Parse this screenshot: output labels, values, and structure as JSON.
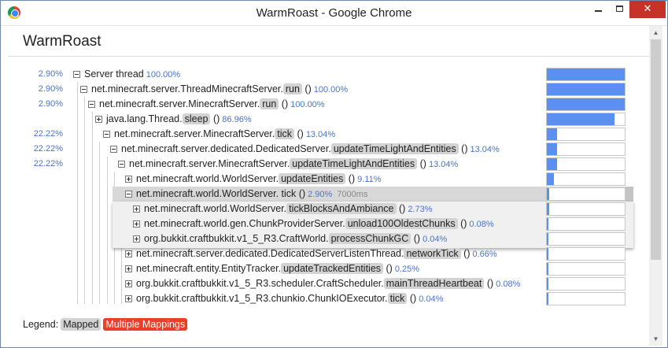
{
  "window": {
    "title": "WarmRoast - Google Chrome",
    "close_glyph": "✕",
    "min_icon": "minimize-icon",
    "max_icon": "maximize-icon",
    "close_icon": "close-icon"
  },
  "app": {
    "title": "WarmRoast"
  },
  "colors": {
    "accent_blue": "#4a74c8",
    "bar_fill": "#5b8ff1",
    "method_bg": "#d3d3d3",
    "multiple_mappings": "#e8402a",
    "close_button": "#c7312a"
  },
  "rows": [
    {
      "pct": "2.90%",
      "prefix": "Server thread",
      "method": "",
      "suffix": "",
      "nodepct": "100.00%",
      "time": "",
      "bar": 1.0,
      "toggle": "minus"
    },
    {
      "pct": "2.90%",
      "prefix": "net.minecraft.server.ThreadMinecraftServer.",
      "method": "run",
      "suffix": " ()",
      "nodepct": "100.00%",
      "time": "",
      "bar": 1.0,
      "toggle": "minus"
    },
    {
      "pct": "2.90%",
      "prefix": "net.minecraft.server.MinecraftServer.",
      "method": "run",
      "suffix": " ()",
      "nodepct": "100.00%",
      "time": "",
      "bar": 1.0,
      "toggle": "minus"
    },
    {
      "pct": "",
      "prefix": "java.lang.Thread.",
      "method": "sleep",
      "suffix": " ()",
      "nodepct": "86.96%",
      "time": "",
      "bar": 0.8696,
      "toggle": "plus"
    },
    {
      "pct": "22.22%",
      "prefix": "net.minecraft.server.MinecraftServer.",
      "method": "tick",
      "suffix": " ()",
      "nodepct": "13.04%",
      "time": "",
      "bar": 0.1304,
      "toggle": "minus"
    },
    {
      "pct": "22.22%",
      "prefix": "net.minecraft.server.dedicated.DedicatedServer.",
      "method": "updateTimeLightAndEntities",
      "suffix": " ()",
      "nodepct": "13.04%",
      "time": "",
      "bar": 0.1304,
      "toggle": "minus"
    },
    {
      "pct": "22.22%",
      "prefix": "net.minecraft.server.MinecraftServer.",
      "method": "updateTimeLightAndEntities",
      "suffix": " ()",
      "nodepct": "13.04%",
      "time": "",
      "bar": 0.1304,
      "toggle": "minus"
    },
    {
      "pct": "",
      "prefix": "net.minecraft.world.WorldServer.",
      "method": "updateEntities",
      "suffix": " ()",
      "nodepct": "9.11%",
      "time": "",
      "bar": 0.0911,
      "toggle": "plus"
    },
    {
      "pct": "",
      "prefix": "net.minecraft.world.WorldServer. tick ()",
      "method": "",
      "suffix": "",
      "nodepct": "2.90%",
      "time": "7000ms",
      "bar": 0.029,
      "toggle": "minus"
    },
    {
      "pct": "",
      "prefix": "net.minecraft.world.WorldServer.",
      "method": "tickBlocksAndAmbiance",
      "suffix": " ()",
      "nodepct": "2.73%",
      "time": "",
      "bar": 0.0273,
      "toggle": "plus"
    },
    {
      "pct": "",
      "prefix": "net.minecraft.world.gen.ChunkProviderServer.",
      "method": "unload100OldestChunks",
      "suffix": " ()",
      "nodepct": "0.08%",
      "time": "",
      "bar": 0.0008,
      "toggle": "plus"
    },
    {
      "pct": "",
      "prefix": "org.bukkit.craftbukkit.v1_5_R3.CraftWorld.",
      "method": "processChunkGC",
      "suffix": " ()",
      "nodepct": "0.04%",
      "time": "",
      "bar": 0.0004,
      "toggle": "plus"
    },
    {
      "pct": "",
      "prefix": "net.minecraft.server.dedicated.DedicatedServerListenThread.",
      "method": "networkTick",
      "suffix": " ()",
      "nodepct": "0.66%",
      "time": "",
      "bar": 0.0066,
      "toggle": "plus"
    },
    {
      "pct": "",
      "prefix": "net.minecraft.entity.EntityTracker.",
      "method": "updateTrackedEntities",
      "suffix": " ()",
      "nodepct": "0.25%",
      "time": "",
      "bar": 0.0025,
      "toggle": "plus"
    },
    {
      "pct": "",
      "prefix": "org.bukkit.craftbukkit.v1_5_R3.scheduler.CraftScheduler.",
      "method": "mainThreadHeartbeat",
      "suffix": " ()",
      "nodepct": "0.08%",
      "time": "",
      "bar": 0.0008,
      "toggle": "plus"
    },
    {
      "pct": "",
      "prefix": "org.bukkit.craftbukkit.v1_5_R3.chunkio.ChunkIOExecutor.",
      "method": "tick",
      "suffix": " ()",
      "nodepct": "0.04%",
      "time": "",
      "bar": 0.0004,
      "toggle": "plus"
    }
  ],
  "legend": {
    "label": "Legend:",
    "mapped": "Mapped",
    "multiple": "Multiple Mappings"
  }
}
